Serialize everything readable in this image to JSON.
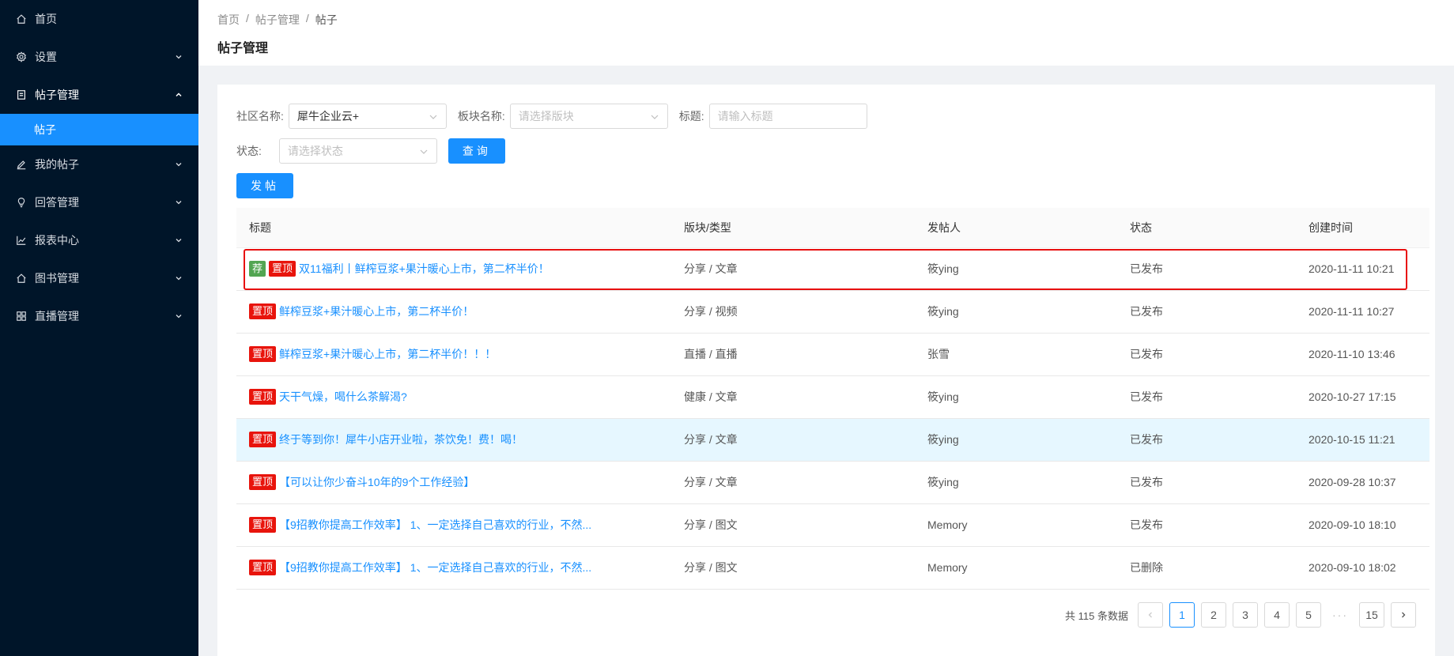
{
  "sidebar": {
    "items": [
      {
        "label": "首页",
        "icon": "home-icon",
        "expandable": false
      },
      {
        "label": "设置",
        "icon": "gear-icon",
        "expandable": true
      },
      {
        "label": "帖子管理",
        "icon": "document-icon",
        "expandable": true,
        "open": true,
        "sub": "帖子"
      },
      {
        "label": "我的帖子",
        "icon": "edit-icon",
        "expandable": true
      },
      {
        "label": "回答管理",
        "icon": "bulb-icon",
        "expandable": true
      },
      {
        "label": "报表中心",
        "icon": "line-chart-icon",
        "expandable": true
      },
      {
        "label": "图书管理",
        "icon": "home-icon",
        "expandable": true
      },
      {
        "label": "直播管理",
        "icon": "grid-icon",
        "expandable": true
      }
    ]
  },
  "header": {
    "breadcrumb": [
      "首页",
      "帖子管理",
      "帖子"
    ],
    "title": "帖子管理"
  },
  "filters": {
    "community_label": "社区名称:",
    "community_value": "犀牛企业云+",
    "board_label": "板块名称:",
    "board_placeholder": "请选择版块",
    "title_label": "标题:",
    "title_placeholder": "请输入标题",
    "status_label": "状态:",
    "status_placeholder": "请选择状态",
    "query_button": "查询",
    "post_button": "发帖"
  },
  "table": {
    "columns": [
      "标题",
      "版块/类型",
      "发帖人",
      "状态",
      "创建时间"
    ],
    "rows": [
      {
        "tags": [
          "荐",
          "置顶"
        ],
        "title": "双11福利丨鲜榨豆浆+果汁暖心上市，第二杯半价！",
        "board": "分享 / 文章",
        "author": "筱ying",
        "status": "已发布",
        "time": "2020-11-11 10:21"
      },
      {
        "tags": [
          "置顶"
        ],
        "title": "鲜榨豆浆+果汁暖心上市，第二杯半价！",
        "board": "分享 / 视频",
        "author": "筱ying",
        "status": "已发布",
        "time": "2020-11-11 10:27"
      },
      {
        "tags": [
          "置顶"
        ],
        "title": "鲜榨豆浆+果汁暖心上市，第二杯半价！！！",
        "board": "直播 / 直播",
        "author": "张雪",
        "status": "已发布",
        "time": "2020-11-10 13:46"
      },
      {
        "tags": [
          "置顶"
        ],
        "title": "天干气燥，喝什么茶解渴?",
        "board": "健康 / 文章",
        "author": "筱ying",
        "status": "已发布",
        "time": "2020-10-27 17:15"
      },
      {
        "tags": [
          "置顶"
        ],
        "title": "终于等到你！犀牛小店开业啦，茶饮免！费！喝！",
        "board": "分享 / 文章",
        "author": "筱ying",
        "status": "已发布",
        "time": "2020-10-15 11:21"
      },
      {
        "tags": [
          "置顶"
        ],
        "title": "【可以让你少奋斗10年的9个工作经验】",
        "board": "分享 / 文章",
        "author": "筱ying",
        "status": "已发布",
        "time": "2020-09-28 10:37"
      },
      {
        "tags": [
          "置顶"
        ],
        "title": "【9招教你提高工作效率】 1、一定选择自己喜欢的行业，不然...",
        "board": "分享 / 图文",
        "author": "Memory",
        "status": "已发布",
        "time": "2020-09-10 18:10"
      },
      {
        "tags": [
          "置顶"
        ],
        "title": "【9招教你提高工作效率】 1、一定选择自己喜欢的行业，不然...",
        "board": "分享 / 图文",
        "author": "Memory",
        "status": "已删除",
        "time": "2020-09-10 18:02"
      }
    ]
  },
  "pagination": {
    "total_text": "共 115 条数据",
    "pages": [
      "1",
      "2",
      "3",
      "4",
      "5"
    ],
    "ellipsis": "···",
    "last": "15",
    "current": "1"
  },
  "colors": {
    "primary": "#1890ff",
    "sidebar": "#001529",
    "tag_red": "#e8140c",
    "tag_green": "#52a552",
    "highlight_box": "#e81010"
  }
}
